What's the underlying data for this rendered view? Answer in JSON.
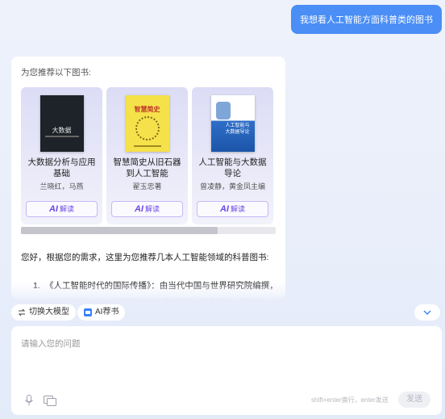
{
  "user_message": "我想看人工智能方面科普类的图书",
  "recommend": {
    "heading": "为您推荐以下图书:",
    "books": [
      {
        "cover_text": "大数据",
        "title": "大数据分析与应用基础",
        "author": "兰晓红，马燕"
      },
      {
        "cover_text": "智慧简史",
        "title": "智慧简史从旧石器到人工智能",
        "author": "翟玉忠著"
      },
      {
        "cover_text": "人工智能与大数据导论",
        "title": "人工智能与大数据导论",
        "author": "曾凌静，黄金凤主编"
      }
    ],
    "ai_read_logo": "AI",
    "ai_read_label": "解读"
  },
  "reply": {
    "intro": "您好，根据您的需求，这里为您推荐几本人工智能领域的科普图书:",
    "items": [
      {
        "num": "1.",
        "text": "《人工智能时代的国际传播》：由当代中国与世界研究院编撰，这本书探讨了人工智能技术如何影响国际传播格局，适合对AI在媒体和传"
      }
    ]
  },
  "toolbar": {
    "switch_model": "切换大模型",
    "ai_recommend": "AI荐书"
  },
  "input": {
    "placeholder": "请输入您的问题",
    "hint": "shift+enter换行，enter发送",
    "send_label": "发送"
  },
  "colors": {
    "accent": "#4a8ef6",
    "ai_purple": "#6c48e6"
  }
}
